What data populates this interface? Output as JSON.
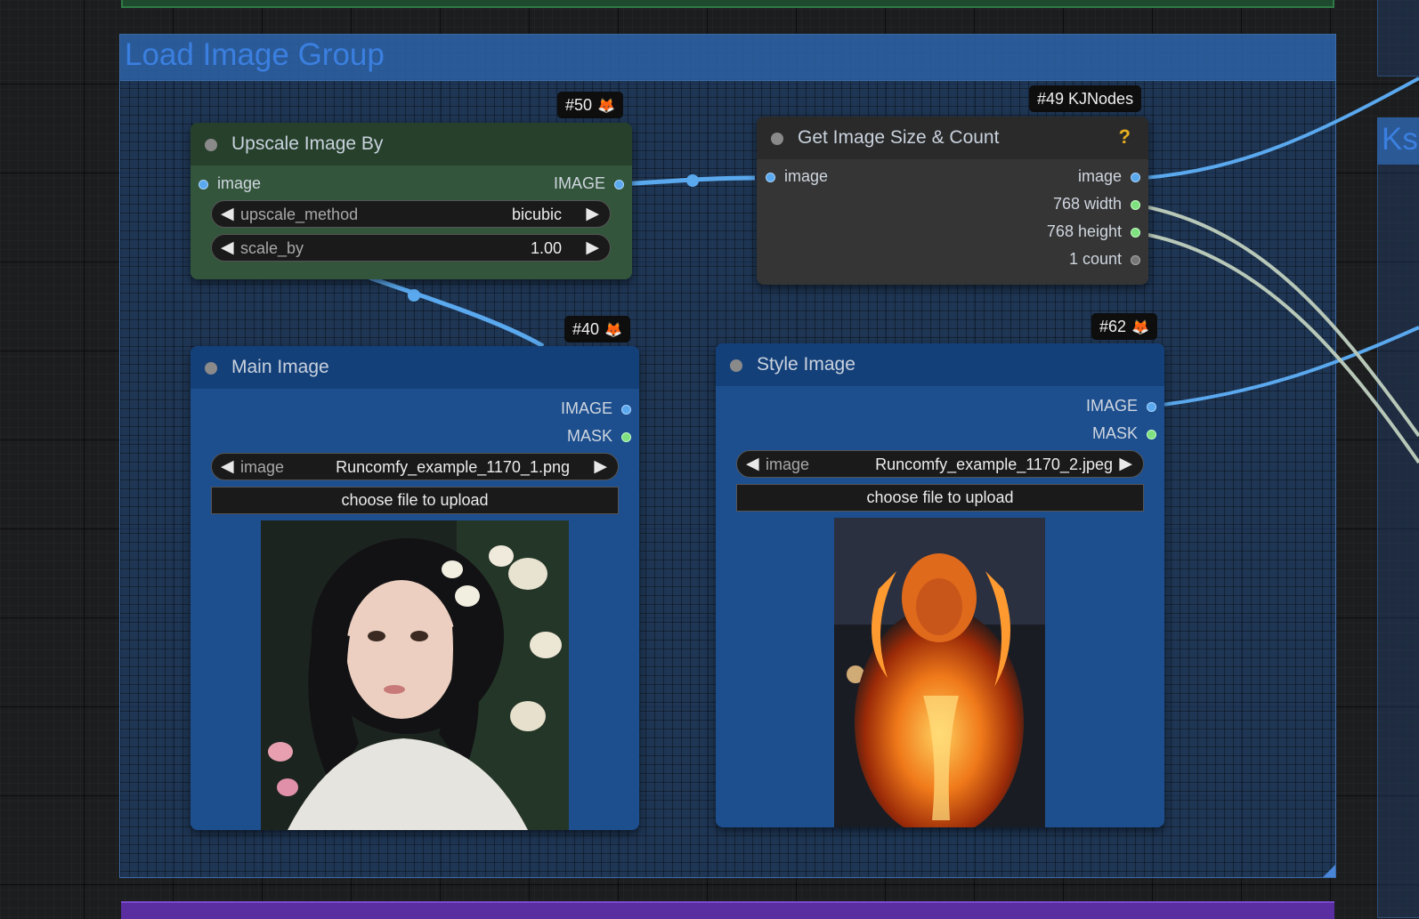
{
  "canvas": {
    "groups": {
      "load_image_group": {
        "title": "Load Image Group"
      },
      "right_group": {
        "title": "Ks"
      },
      "bottom_group": {
        "title": ""
      }
    },
    "nodes": {
      "upscale": {
        "badge_id": "#50",
        "title": "Upscale Image By",
        "input_label": "image",
        "output_label": "IMAGE",
        "widgets": [
          {
            "name": "upscale_method",
            "value": "bicubic"
          },
          {
            "name": "scale_by",
            "value": "1.00"
          }
        ]
      },
      "get_size": {
        "badge_id": "#49 KJNodes",
        "title": "Get Image Size & Count",
        "help_icon": "?",
        "input_label": "image",
        "outputs": [
          "image",
          "768 width",
          "768 height",
          "1 count"
        ]
      },
      "main_image": {
        "badge_id": "#40",
        "title": "Main Image",
        "outputs": [
          "IMAGE",
          "MASK"
        ],
        "widget": {
          "name": "image",
          "value": "Runcomfy_example_1170_1.png"
        },
        "upload_label": "choose file to upload"
      },
      "style_image": {
        "badge_id": "#62",
        "title": "Style Image",
        "outputs": [
          "IMAGE",
          "MASK"
        ],
        "widget": {
          "name": "image",
          "value": "Runcomfy_example_1170_2.jpeg"
        },
        "upload_label": "choose file to upload"
      }
    },
    "colors": {
      "image_link": "#5aa8ee",
      "int_link": "#b8c8b8",
      "group_blue": "#3b7fe0",
      "badge_fox": "#f07a2a"
    }
  }
}
